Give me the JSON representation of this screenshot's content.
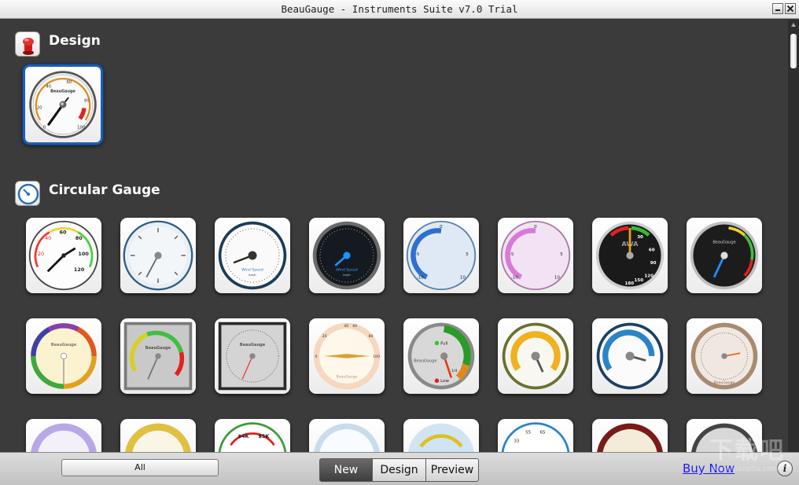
{
  "window": {
    "title": "BeauGauge - Instruments Suite v7.0 Trial"
  },
  "sections": {
    "design": {
      "title": "Design"
    },
    "circular": {
      "title": "Circular Gauge"
    }
  },
  "design_gauge": {
    "brand": "BeauGauge",
    "ticks": [
      "0",
      "20",
      "40",
      "60",
      "80",
      "100"
    ]
  },
  "circular_row1": [
    {
      "name": "gauge-green-red-scale",
      "ticks": [
        "20",
        "40",
        "60",
        "80",
        "100",
        "120"
      ]
    },
    {
      "name": "gauge-silver-plain",
      "ticks": []
    },
    {
      "name": "gauge-wind-speed-white",
      "caption": "Wind Speed",
      "unit": "km/h"
    },
    {
      "name": "gauge-wind-speed-dark",
      "caption": "Wind Speed",
      "unit": "km/h"
    },
    {
      "name": "gauge-blue-arc",
      "ticks": [
        "-10",
        "-5",
        "0",
        "5",
        "10"
      ]
    },
    {
      "name": "gauge-pink-arc",
      "ticks": [
        "-10",
        "-5",
        "0",
        "5",
        "10"
      ]
    },
    {
      "name": "gauge-awa",
      "label": "AWA",
      "ticks": [
        "30",
        "60",
        "90",
        "120",
        "150",
        "180"
      ]
    },
    {
      "name": "gauge-dark-green-red",
      "brand": "BeauGauge"
    }
  ],
  "circular_row2": [
    {
      "name": "gauge-rainbow-ring",
      "brand": "BeauGauge"
    },
    {
      "name": "gauge-square-metal-color",
      "brand": "BeauGauge"
    },
    {
      "name": "gauge-square-metal-plain",
      "brand": "BeauGauge"
    },
    {
      "name": "gauge-cream-half",
      "brand": "BeauGauge",
      "ticks": [
        "0",
        "20",
        "40",
        "60",
        "80",
        "100"
      ]
    },
    {
      "name": "gauge-fuel",
      "brand": "BeauGauge",
      "full": "Full",
      "low": "Low",
      "quarter": "1/4"
    },
    {
      "name": "gauge-olive-yellow",
      "brand": "BeauGauge"
    },
    {
      "name": "gauge-blue-ring",
      "brand": "BeauGauge"
    },
    {
      "name": "gauge-bronze",
      "brand": "BeauGauge"
    }
  ],
  "circular_row3_labels": [
    "$4K",
    "$5K",
    "55",
    "65",
    "33"
  ],
  "bottom": {
    "all_label": "All",
    "tab_new": "New",
    "tab_design": "Design",
    "tab_preview": "Preview",
    "buy_now": "Buy Now",
    "info": "i"
  },
  "watermark": {
    "big": "下载吧",
    "small": "www.xiazaiba.com"
  }
}
